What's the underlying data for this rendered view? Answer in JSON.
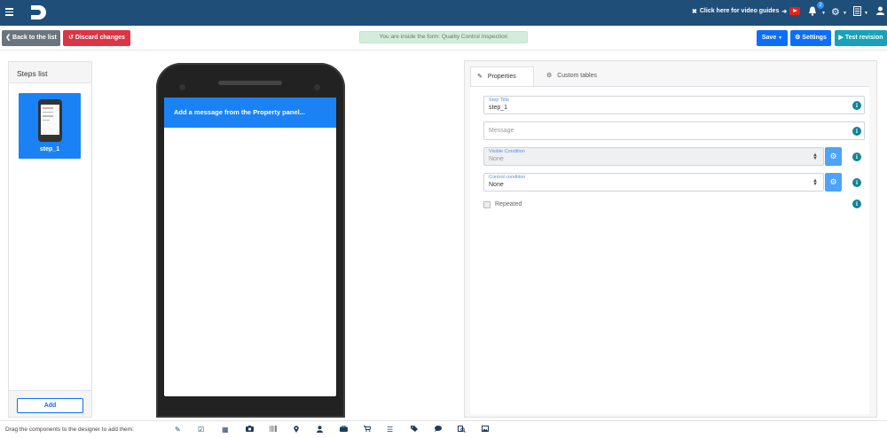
{
  "topnav": {
    "video_link": "Click here for video guides",
    "notification_count": "2"
  },
  "toolbar": {
    "back_label": "Back to the list",
    "discard_label": "Discard changes",
    "info": "You are inside the form: Quality Control Inspection",
    "save_label": "Save",
    "settings_label": "Settings",
    "test_label": "Test revision"
  },
  "steps": {
    "title": "Steps list",
    "items": [
      {
        "label": "step_1"
      }
    ],
    "add_label": "Add"
  },
  "phone": {
    "message": "Add a message from the Property panel..."
  },
  "properties": {
    "tabs": [
      {
        "label": "Properties"
      },
      {
        "label": "Custom tables"
      }
    ],
    "step_title": {
      "label": "Step Title",
      "value": "step_1"
    },
    "message": {
      "placeholder": "Message"
    },
    "visible_condition": {
      "label": "Visible Condition",
      "value": "None"
    },
    "control_condition": {
      "label": "Control condition",
      "value": "None"
    },
    "repeated_label": "Repeated"
  },
  "bottombar": {
    "label": "Drag the components to the designer to add them:"
  },
  "colors": {
    "nav": "#1f4e79",
    "primary": "#0d6efd",
    "danger": "#dc3545",
    "info": "#17a2b8",
    "step_card": "#1a82f5"
  }
}
